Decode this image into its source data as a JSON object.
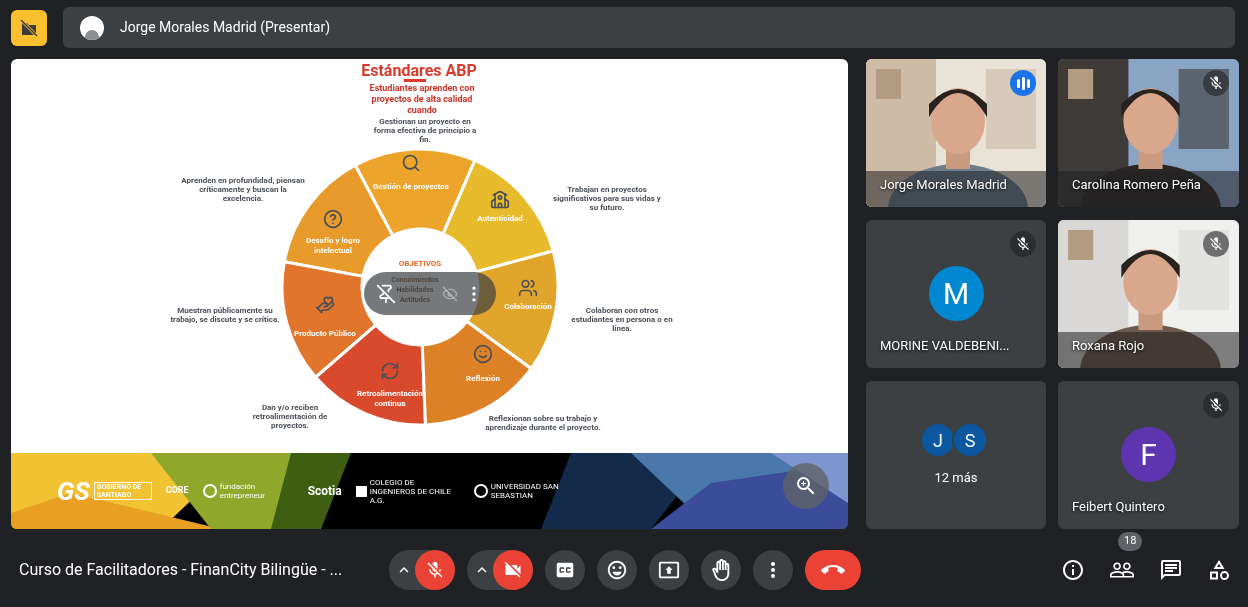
{
  "top_bar": {
    "presenter_label": "Jorge Morales Madrid (Presentar)"
  },
  "slide": {
    "title": "Estándares ABP",
    "subtitle": "Estudiantes aprenden con proyectos de alta calidad cuando",
    "center_heading": "OBJETIVOS",
    "center_items": [
      "Conocimientos",
      "Habilidades",
      "Actitudes"
    ],
    "segments": [
      {
        "kind": "search",
        "label": "Gestión de proyectos",
        "description": "Gestionan un proyecto en forma efectiva de principio a fin.",
        "color": "#eca52a"
      },
      {
        "kind": "question",
        "label": "Desafío y logro intelectual",
        "description": "Aprenden en profundidad, piensan críticamente y buscan la excelencia.",
        "color": "#e89a2b"
      },
      {
        "kind": "school",
        "label": "Autenticidad",
        "description": "Trabajan en proyectos significativos para sus vidas y su futuro.",
        "color": "#e8bb2c"
      },
      {
        "kind": "product",
        "label": "Producto Público",
        "description": "Muestran públicamente su trabajo, se discute y se crítica.",
        "color": "#e1752c"
      },
      {
        "kind": "people",
        "label": "Colaboración",
        "description": "Colaboran con otros estudiantes en persona o en línea.",
        "color": "#e2a52b"
      },
      {
        "kind": "refresh",
        "label": "Retroalimentación continua",
        "description": "Dan y/o reciben retroalimentación de proyectos.",
        "color": "#d84a2b"
      },
      {
        "kind": "thinking",
        "label": "Reflexión",
        "description": "Reflexionan sobre su trabajo y aprendizaje durante el proyecto.",
        "color": "#dd8127"
      }
    ],
    "footer_logos": [
      {
        "kind": "gs",
        "text": "GS",
        "caption": "GOBIERNO DE SANTIAGO"
      },
      {
        "kind": "star",
        "text": "CORE"
      },
      {
        "kind": "ring",
        "text": "fundación entrepreneur"
      },
      {
        "kind": "plain",
        "text": "Scotia"
      },
      {
        "kind": "square",
        "text": "COLEGIO DE INGENIEROS DE CHILE A.G."
      },
      {
        "kind": "ring",
        "text": "UNIVERSIDAD SAN SEBASTIAN"
      }
    ]
  },
  "participants": [
    {
      "kind": "video",
      "name": "Jorge Morales Madrid",
      "speaking": true
    },
    {
      "kind": "video",
      "name": "Carolina Romero Peña",
      "muted": true,
      "speaking": false
    },
    {
      "kind": "avatar",
      "name": "MORINE VALDEBENI...",
      "initial": "M",
      "color": "#0288d1",
      "muted": true,
      "speaking": false
    },
    {
      "kind": "video",
      "name": "Roxana Rojo",
      "muted": true,
      "speaking": false
    },
    {
      "kind": "more",
      "label": "12 más",
      "initials": [
        "J",
        "S"
      ]
    },
    {
      "kind": "avatar",
      "name": "Feibert Quintero",
      "initial": "F",
      "color": "#5e35b1",
      "muted": true,
      "speaking": false
    }
  ],
  "bottom_bar": {
    "meeting_title": "Curso de Facilitadores - FinanCity Bilingüe - ...",
    "mic_on": false,
    "camera_on": false,
    "people_count": "18"
  }
}
